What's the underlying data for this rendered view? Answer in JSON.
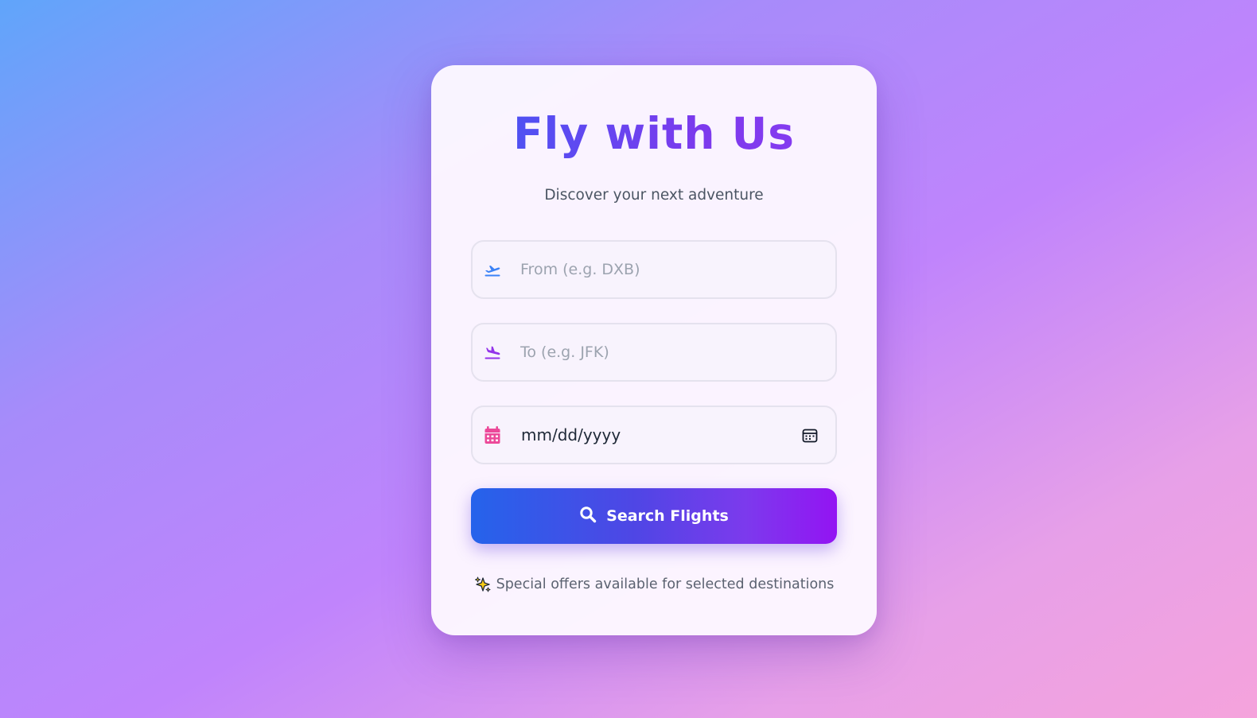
{
  "card": {
    "title": "Fly with Us",
    "subtitle": "Discover your next adventure"
  },
  "form": {
    "from": {
      "placeholder": "From (e.g. DXB)",
      "icon": "plane-departure-icon",
      "icon_color": "#3b82f6"
    },
    "to": {
      "placeholder": "To (e.g. JFK)",
      "icon": "plane-arrival-icon",
      "icon_color": "#9333ea"
    },
    "date": {
      "value": "mm/dd/yyyy",
      "icon": "calendar-icon",
      "icon_color": "#ec4899",
      "picker_icon": "calendar-picker-icon"
    },
    "search_button": {
      "label": "Search Flights",
      "icon": "search-icon"
    }
  },
  "footer": {
    "icon": "sparkles-icon",
    "text": "Special offers available for selected destinations"
  },
  "colors": {
    "title_gradient_start": "#3b5bf5",
    "title_gradient_end": "#8b3cf2",
    "button_gradient_start": "#2563eb",
    "button_gradient_end": "#9314f3"
  }
}
